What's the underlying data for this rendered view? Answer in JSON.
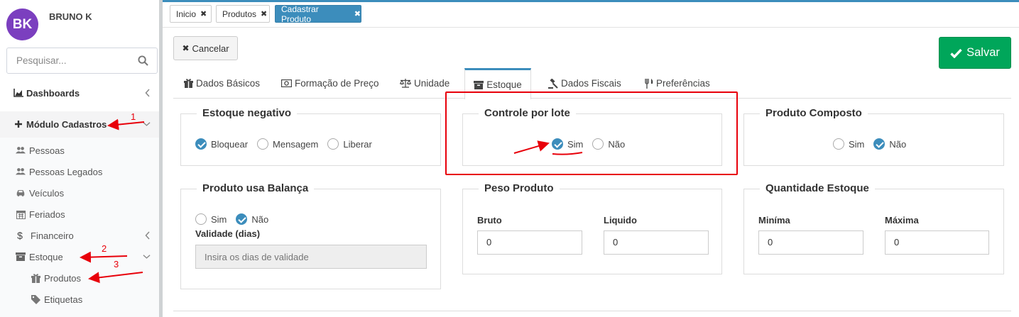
{
  "user": {
    "initials": "BK",
    "name": "BRUNO K",
    "avatar_color": "#7b3fbf"
  },
  "search": {
    "placeholder": "Pesquisar..."
  },
  "sidebar": {
    "items": [
      {
        "label": "Dashboards",
        "icon": "area-chart-icon"
      },
      {
        "label": "Módulo Cadastros",
        "icon": "plus-icon"
      },
      {
        "label": "Pessoas",
        "icon": "users-icon"
      },
      {
        "label": "Pessoas Legados",
        "icon": "users-icon"
      },
      {
        "label": "Veículos",
        "icon": "car-icon"
      },
      {
        "label": "Feriados",
        "icon": "calendar-icon"
      },
      {
        "label": "Financeiro",
        "icon": "dollar-icon"
      },
      {
        "label": "Estoque",
        "icon": "archive-icon"
      },
      {
        "label": "Produtos",
        "icon": "gift-icon"
      },
      {
        "label": "Etiquetas",
        "icon": "tag-icon"
      }
    ]
  },
  "top_tabs": [
    {
      "label": "Inicio",
      "active": false
    },
    {
      "label": "Produtos",
      "active": false
    },
    {
      "label": "Cadastrar Produto",
      "active": true
    }
  ],
  "buttons": {
    "cancel": "Cancelar",
    "save": "Salvar"
  },
  "content_tabs": [
    {
      "label": "Dados Básicos",
      "icon": "gift-icon"
    },
    {
      "label": "Formação de Preço",
      "icon": "money-icon"
    },
    {
      "label": "Unidade",
      "icon": "balance-scale-icon"
    },
    {
      "label": "Estoque",
      "icon": "archive-icon",
      "active": true
    },
    {
      "label": "Dados Fiscais",
      "icon": "gavel-icon"
    },
    {
      "label": "Preferências",
      "icon": "cutlery-icon"
    }
  ],
  "estoque_negativo": {
    "title": "Estoque negativo",
    "options": [
      "Bloquear",
      "Mensagem",
      "Liberar"
    ],
    "selected": "Bloquear"
  },
  "controle_lote": {
    "title": "Controle por lote",
    "options": [
      "Sim",
      "Não"
    ],
    "selected": "Sim"
  },
  "produto_composto": {
    "title": "Produto Composto",
    "options": [
      "Sim",
      "Não"
    ],
    "selected": "Não"
  },
  "balanca": {
    "title": "Produto usa Balança",
    "options": [
      "Sim",
      "Não"
    ],
    "selected": "Não",
    "validade_label": "Validade (dias)",
    "validade_placeholder": "Insira os dias de validade"
  },
  "peso": {
    "title": "Peso Produto",
    "bruto_label": "Bruto",
    "bruto_value": "0",
    "liquido_label": "Liquido",
    "liquido_value": "0"
  },
  "quantidade": {
    "title": "Quantidade Estoque",
    "min_label": "Miníma",
    "min_value": "0",
    "max_label": "Máxima",
    "max_value": "0"
  },
  "annotations": {
    "a1": "1",
    "a2": "2",
    "a3": "3"
  },
  "colors": {
    "primary": "#3c8dbc",
    "success": "#00a65a",
    "annotation": "#e8000a"
  }
}
